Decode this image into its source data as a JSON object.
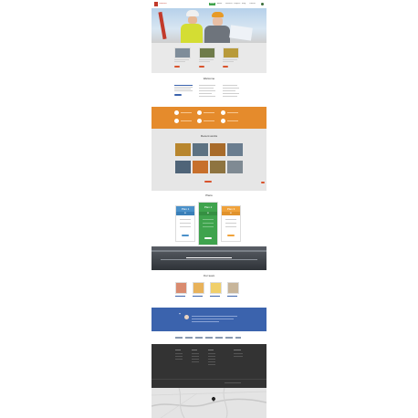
{
  "header": {
    "logo_label": "Construct",
    "nav": [
      "Home",
      "About",
      "Services",
      "Projects",
      "Blog",
      "Contact"
    ],
    "active_nav_index": 0
  },
  "welcome": {
    "title": "Welcome"
  },
  "recent_works": {
    "title": "Recent works"
  },
  "plans": {
    "title": "Plans",
    "items": [
      {
        "name": "Plan 1",
        "price": "$5",
        "color": "#4a90c9"
      },
      {
        "name": "Plan 2",
        "price": "$9",
        "color": "#3fa34d"
      },
      {
        "name": "Plan 3",
        "price": "$9",
        "color": "#f0a23a"
      }
    ]
  },
  "our_team": {
    "title": "Our team"
  },
  "colors": {
    "accent_orange": "#e58b2c",
    "accent_blue": "#3b63ad",
    "footer_dark": "#333333",
    "button_red": "#d9532c"
  }
}
